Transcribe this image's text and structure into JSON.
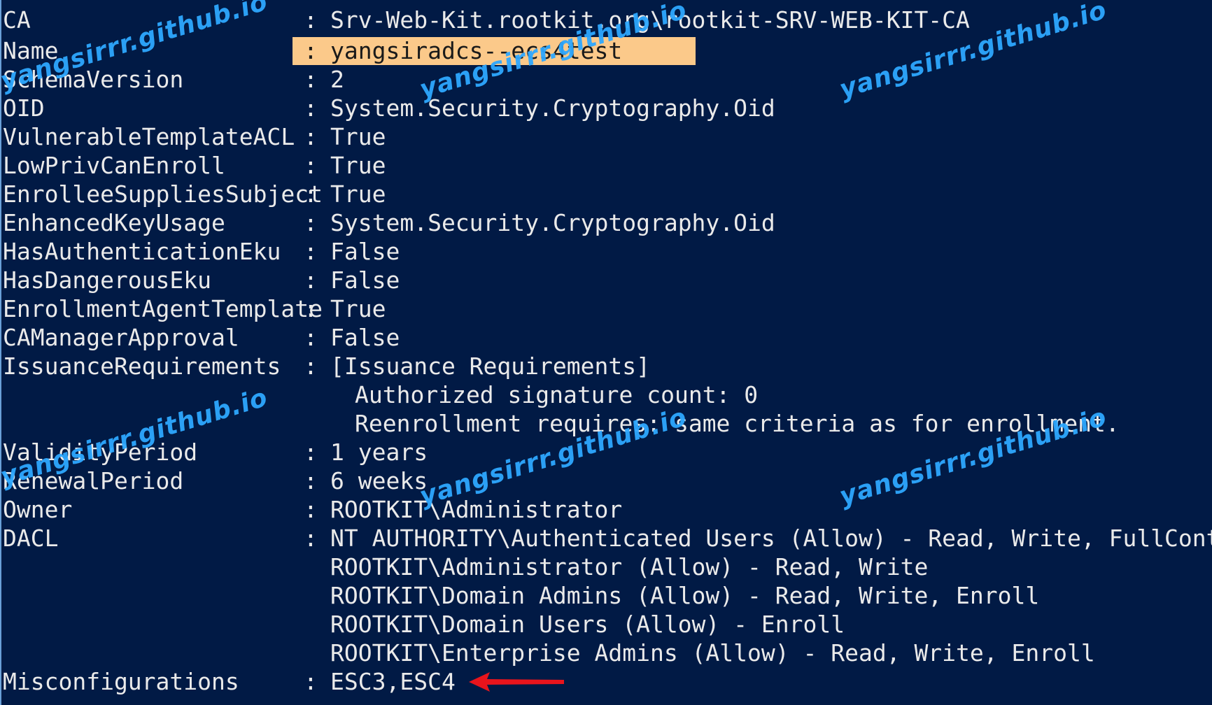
{
  "rows": [
    {
      "key": "CA",
      "value": "Srv-Web-Kit.rootkit.org\\rootkit-SRV-WEB-KIT-CA"
    },
    {
      "key": "Name",
      "value": "yangsiradcs--ecs4test"
    },
    {
      "key": "SchemaVersion",
      "value": "2"
    },
    {
      "key": "OID",
      "value": "System.Security.Cryptography.Oid"
    },
    {
      "key": "VulnerableTemplateACL",
      "value": "True"
    },
    {
      "key": "LowPrivCanEnroll",
      "value": "True"
    },
    {
      "key": "EnrolleeSuppliesSubject",
      "value": "True"
    },
    {
      "key": "EnhancedKeyUsage",
      "value": "System.Security.Cryptography.Oid"
    },
    {
      "key": "HasAuthenticationEku",
      "value": "False"
    },
    {
      "key": "HasDangerousEku",
      "value": "False"
    },
    {
      "key": "EnrollmentAgentTemplate",
      "value": "True"
    },
    {
      "key": "CAManagerApproval",
      "value": "False"
    },
    {
      "key": "IssuanceRequirements",
      "value": "[Issuance Requirements]"
    },
    {
      "key": "",
      "value": "Authorized signature count: 0"
    },
    {
      "key": "",
      "value": "Reenrollment requires: same criteria as for enrollment."
    },
    {
      "key": "ValidityPeriod",
      "value": "1 years"
    },
    {
      "key": "RenewalPeriod",
      "value": "6 weeks"
    },
    {
      "key": "Owner",
      "value": "ROOTKIT\\Administrator"
    },
    {
      "key": "DACL",
      "value": "NT AUTHORITY\\Authenticated Users (Allow) - Read, Write, FullControl"
    },
    {
      "key": "",
      "value": "ROOTKIT\\Administrator (Allow) - Read, Write"
    },
    {
      "key": "",
      "value": "ROOTKIT\\Domain Admins (Allow) - Read, Write, Enroll"
    },
    {
      "key": "",
      "value": "ROOTKIT\\Domain Users (Allow) - Enroll"
    },
    {
      "key": "",
      "value": "ROOTKIT\\Enterprise Admins (Allow) - Read, Write, Enroll"
    },
    {
      "key": "Misconfigurations",
      "value": "ESC3,ESC4"
    }
  ],
  "separator": ":",
  "watermark": "yangsirrr.github.io",
  "colors": {
    "terminal_background": "#011a45",
    "text": "#eaeaea",
    "highlight": "#fbc98a",
    "watermark": "#2ea8ff",
    "arrow": "#e8141c"
  },
  "icons": {
    "annotation_arrow": "left-pointing red arrow marking Misconfigurations"
  }
}
